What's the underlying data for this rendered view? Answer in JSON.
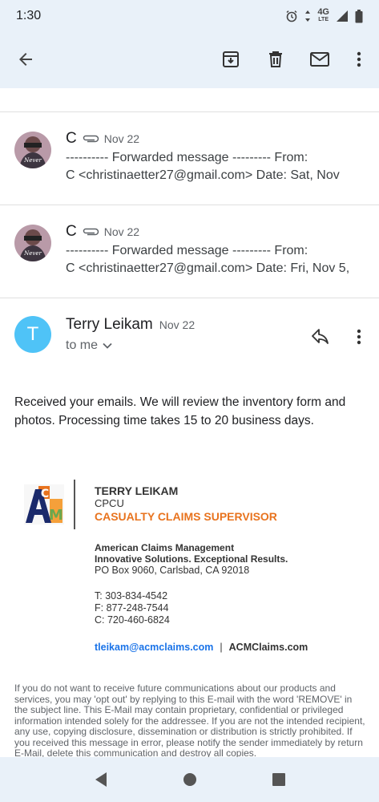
{
  "status_bar": {
    "time": "1:30",
    "network": "4G",
    "network_sub": "LTE"
  },
  "app_bar": {
    "back_icon": "arrow-left-icon",
    "archive_icon": "archive-icon",
    "delete_icon": "trash-icon",
    "mark_unread_icon": "mail-icon",
    "more_icon": "more-vert-icon"
  },
  "thread": [
    {
      "sender": "C",
      "date": "Nov 22",
      "has_attachment": true,
      "snippet": "---------- Forwarded message --------- From:\nC <christinaetter27@gmail.com> Date: Sat, Nov"
    },
    {
      "sender": "C",
      "date": "Nov 22",
      "has_attachment": true,
      "snippet": "---------- Forwarded message --------- From:\nC <christinaetter27@gmail.com> Date: Fri, Nov 5,"
    }
  ],
  "message": {
    "avatar_letter": "T",
    "sender": "Terry Leikam",
    "date": "Nov 22",
    "to": "to me",
    "body": "Received your emails. We will review the inventory form and photos. Processing time takes 15 to 20 business days."
  },
  "signature": {
    "name": "TERRY LEIKAM",
    "credential": "CPCU",
    "title": "CASUALTY CLAIMS SUPERVISOR",
    "company": "American Claims Management",
    "tagline": "Innovative Solutions. Exceptional Results.",
    "address": "PO Box 9060, Carlsbad, CA 92018",
    "phone_t": "T: 303-834-4542",
    "phone_f": "F: 877-248-7544",
    "phone_c": "C: 720-460-6824",
    "email": "tleikam@acmclaims.com",
    "separator": "|",
    "website": "ACMClaims.com",
    "logo_text": "ACM"
  },
  "disclaimer": "If you do not want to receive future communications about our products and services, you may 'opt out' by replying to this E-mail with the word 'REMOVE' in the subject line. This E-Mail may contain proprietary, confidential or privileged information intended solely for the addressee. If you are not the intended recipient, any use, copying disclosure, dissemination or distribution is strictly prohibited. If you received this message in error, please notify the sender immediately by return E-Mail, delete this communication and destroy all copies.",
  "colors": {
    "accent_orange": "#e8731e",
    "link_blue": "#1a73e8",
    "avatar_blue": "#4fc3f7",
    "bar_bg": "#e9f1f9"
  }
}
